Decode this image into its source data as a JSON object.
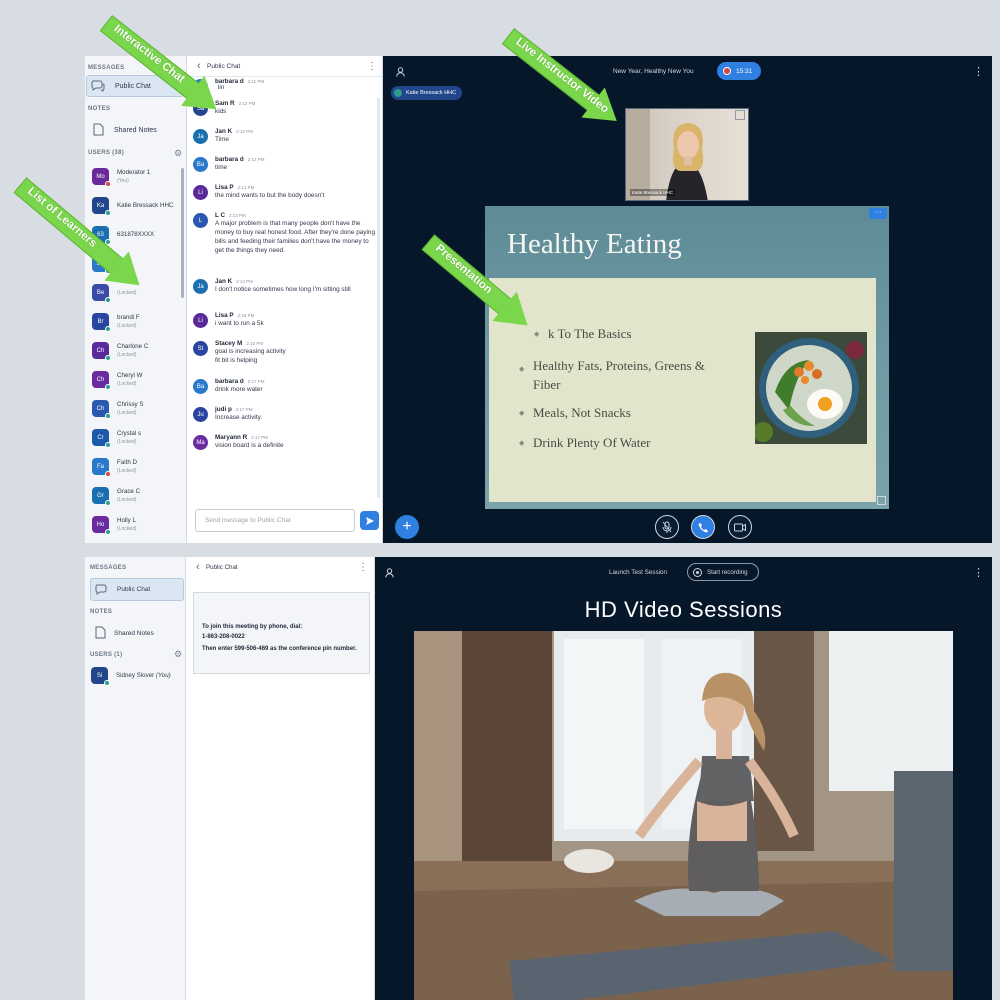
{
  "top": {
    "sidebar": {
      "messages_title": "MESSAGES",
      "public_chat": "Public Chat",
      "notes_title": "NOTES",
      "shared_notes": "Shared Notes",
      "users_title": "USERS (38)",
      "users": [
        {
          "initials": "Mo",
          "name": "Moderator 1",
          "sub": "(You)",
          "color": "#6a2a9b",
          "dot": "red"
        },
        {
          "initials": "Ka",
          "name": "Katie Bressack HHC",
          "sub": "",
          "color": "#22468c",
          "dot": "teal"
        },
        {
          "initials": "63",
          "name": "631878XXXX",
          "sub": "",
          "color": "#1a6fb0",
          "dot": "teal"
        },
        {
          "initials": "Ba",
          "name": "",
          "sub": "",
          "color": "#2a78c9",
          "dot": "teal"
        },
        {
          "initials": "Be",
          "name": "",
          "sub": "(Locked)",
          "color": "#3a4aa8",
          "dot": "teal"
        },
        {
          "initials": "Br",
          "name": "brandi F",
          "sub": "(Locked)",
          "color": "#2a45a0",
          "dot": "teal"
        },
        {
          "initials": "Ch",
          "name": "Charlone C",
          "sub": "(Locked)",
          "color": "#5a2a9b",
          "dot": "teal"
        },
        {
          "initials": "Ch",
          "name": "Cheryl W",
          "sub": "(Locked)",
          "color": "#6a2aa0",
          "dot": "teal"
        },
        {
          "initials": "Ch",
          "name": "Chrissy S",
          "sub": "(Locked)",
          "color": "#2a58b0",
          "dot": "teal"
        },
        {
          "initials": "Cr",
          "name": "Crystal s",
          "sub": "(Locked)",
          "color": "#1a5aa8",
          "dot": "teal"
        },
        {
          "initials": "Fa",
          "name": "Faith D",
          "sub": "(Locked)",
          "color": "#2a78c9",
          "dot": "red"
        },
        {
          "initials": "Gr",
          "name": "Grace C",
          "sub": "(Locked)",
          "color": "#1a6fb0",
          "dot": "teal"
        },
        {
          "initials": "Ho",
          "name": "Holly L",
          "sub": "(Locked)",
          "color": "#6a2aa0",
          "dot": "teal"
        }
      ]
    },
    "chat": {
      "back": "‹",
      "title": "Public Chat",
      "menu": "⋮",
      "input_placeholder": "Send message to Public Chat",
      "partial_top": "lin",
      "messages": [
        {
          "initials": "",
          "name": "barbara d",
          "time": "2:11 PM",
          "text": "",
          "color": "#2a78c9"
        },
        {
          "initials": "Sa",
          "name": "Sam R",
          "time": "2:12 PM",
          "text": "kids",
          "color": "#22468c"
        },
        {
          "initials": "Ja",
          "name": "Jan K",
          "time": "2:12 PM",
          "text": "Time",
          "color": "#1a6fb0"
        },
        {
          "initials": "Ba",
          "name": "barbara d",
          "time": "2:12 PM",
          "text": "time",
          "color": "#2a78c9"
        },
        {
          "initials": "Li",
          "name": "Lisa P",
          "time": "2:12 PM",
          "text": "the mind wants to but the body doesn't",
          "color": "#5a2a9b"
        },
        {
          "initials": "L",
          "name": "L C",
          "time": "2:13 PM",
          "text": "A major problem is that many people don't have the money to buy real honest food. After they're done paying bills and feeding their families don't have the money to get the things they need.",
          "color": "#2a58b0"
        },
        {
          "initials": "Ja",
          "name": "Jan K",
          "time": "2:14 PM",
          "text": "I don't notice sometimes how long I'm sitting still",
          "color": "#1a6fb0"
        },
        {
          "initials": "Li",
          "name": "Lisa P",
          "time": "2:16 PM",
          "text": "i want to run a 5k",
          "color": "#5a2a9b"
        },
        {
          "initials": "St",
          "name": "Stacey M",
          "time": "2:16 PM",
          "text": "goal is increasing activity\nfit bit is helping",
          "color": "#2a45a0"
        },
        {
          "initials": "Ba",
          "name": "barbara d",
          "time": "2:17 PM",
          "text": "drink more water",
          "color": "#2a78c9"
        },
        {
          "initials": "Ju",
          "name": "judi p",
          "time": "2:17 PM",
          "text": "Increase activity.",
          "color": "#2a45a0"
        },
        {
          "initials": "Ma",
          "name": "Maryann R",
          "time": "2:17 PM",
          "text": "vision board is a definite",
          "color": "#6a2aa0"
        }
      ]
    },
    "main": {
      "meeting_title": "New Year, Healthy New You",
      "timer": "15:31",
      "presenter_tag": "Katie Bressack HHC",
      "webcam_label": "Katie Bressack HHC",
      "menu": "⋮",
      "slide": {
        "title": "Healthy Eating",
        "bullets": [
          "Back To The Basics",
          "Healthy Fats, Proteins, Greens & Fiber",
          "Meals, Not Snacks",
          "Drink Plenty Of Water"
        ],
        "partial_first": "k To The Basics"
      }
    }
  },
  "bottom": {
    "sidebar": {
      "messages_title": "MESSAGES",
      "public_chat": "Public Chat",
      "notes_title": "NOTES",
      "shared_notes": "Shared Notes",
      "users_title": "USERS (1)",
      "users": [
        {
          "initials": "Si",
          "name": "Sidney Slover",
          "sub": "(You)",
          "color": "#22468c"
        }
      ]
    },
    "chat": {
      "back": "‹",
      "title": "Public Chat",
      "menu": "⋮",
      "welcome_line1": "To join this meeting by phone, dial:",
      "welcome_line2": "1-863-208-0022",
      "welcome_line3": "Then enter 599-506-469 as the conference pin number."
    },
    "main": {
      "session_title": "Launch Test Session",
      "record_label": "Start recording",
      "heading": "HD Video Sessions",
      "menu": "⋮"
    }
  },
  "annotations": {
    "interactive_chat": "Interactive Chat",
    "live_video": "Live Instructor Video",
    "learners": "List of Learners",
    "presentation": "Presentation"
  },
  "colors": {
    "accent_blue": "#2f80e0",
    "arrow_green": "#7ad64a",
    "dark_bg": "#06172a"
  }
}
